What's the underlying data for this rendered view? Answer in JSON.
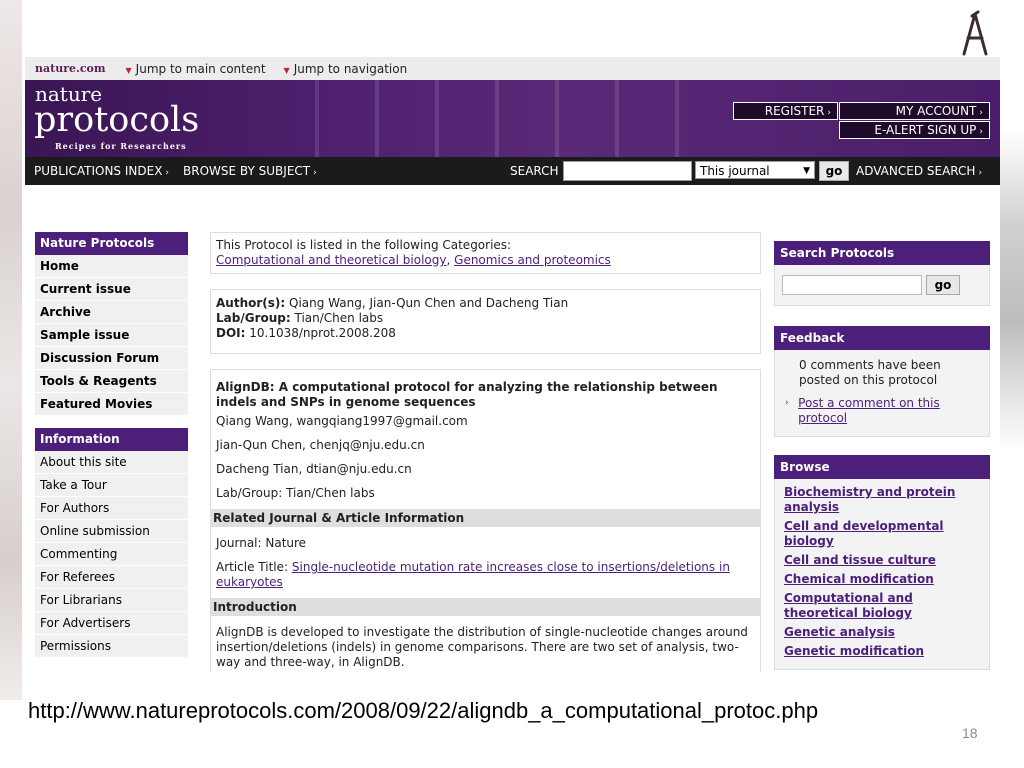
{
  "toplinks": {
    "site": "nature.com",
    "jump_main": "Jump to main content",
    "jump_nav": "Jump to navigation"
  },
  "banner": {
    "brand_nature": "nature",
    "brand_protocols": "protocols",
    "brand_tagline": "Recipes for Researchers",
    "register": "REGISTER",
    "my_account": "MY ACCOUNT",
    "ealert": "E-ALERT SIGN UP"
  },
  "navbar": {
    "publications_index": "PUBLICATIONS INDEX",
    "browse_by_subject": "BROWSE BY SUBJECT",
    "search_label": "SEARCH",
    "scope_selected": "This journal",
    "go": "go",
    "advanced_search": "ADVANCED SEARCH"
  },
  "leftnav": {
    "header1": "Nature Protocols",
    "items1": [
      "Home",
      "Current issue",
      "Archive",
      "Sample issue",
      "Discussion Forum",
      "Tools & Reagents",
      "Featured Movies"
    ],
    "header2": "Information",
    "items2": [
      "About this site",
      "Take a Tour",
      "For Authors",
      "Online submission",
      "Commenting",
      "For Referees",
      "For Librarians",
      "For Advertisers",
      "Permissions"
    ]
  },
  "categories_box": {
    "intro": "This Protocol is listed in the following Categories:",
    "cat1": "Computational and theoretical biology",
    "sep": ",",
    "cat2": "Genomics and proteomics"
  },
  "authors_box": {
    "authors_label": "Author(s):",
    "authors": "Qiang Wang, Jian-Qun Chen and Dacheng Tian",
    "lab_label": "Lab/Group:",
    "lab": "Tian/Chen labs",
    "doi_label": "DOI:",
    "doi": "10.1038/nprot.2008.208"
  },
  "article": {
    "title": "AlignDB: A computational protocol for analyzing the relationship between indels and SNPs in genome sequences",
    "contact1": "Qiang Wang, wangqiang1997@gmail.com",
    "contact2": "Jian-Qun Chen, chenjq@nju.edu.cn",
    "contact3": "Dacheng Tian, dtian@nju.edu.cn",
    "lab_line": "Lab/Group: Tian/Chen labs",
    "related_header": "Related Journal & Article Information",
    "journal": "Journal: Nature",
    "article_title_label": "Article Title:",
    "article_title_link": "Single-nucleotide mutation rate increases close to insertions/deletions in eukaryotes",
    "intro_header": "Introduction",
    "intro_text": "AlignDB is developed to investigate the distribution of single-nucleotide changes around insertion/deletions (indels) in genome comparisons. There are two set of analysis, two-way and three-way, in AlignDB."
  },
  "right": {
    "search_header": "Search Protocols",
    "search_go": "go",
    "feedback_header": "Feedback",
    "feedback_text": "0 comments have been posted on this protocol",
    "feedback_link": "Post a comment on this protocol",
    "browse_header": "Browse",
    "browse_items": [
      "Biochemistry and protein analysis",
      "Cell and developmental biology",
      "Cell and tissue culture",
      "Chemical modification",
      "Computational and theoretical biology",
      "Genetic analysis",
      "Genetic modification"
    ]
  },
  "caption": {
    "url": "http://www.natureprotocols.com/2008/09/22/aligndb_a_computational_protoc.php",
    "page": "18"
  },
  "colors": {
    "brand_purple": "#4b1f7a",
    "nav_black": "#1b1b1b"
  }
}
